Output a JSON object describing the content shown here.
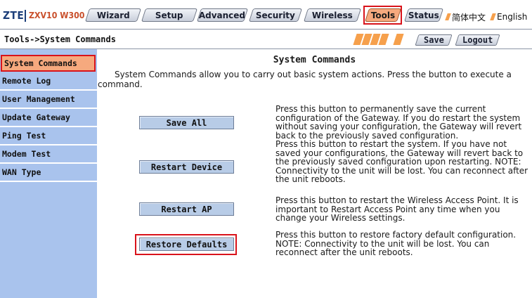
{
  "brand": {
    "logo": "ZTE",
    "model": "ZXV10 W300"
  },
  "nav": {
    "tabs": [
      {
        "label": "Wizard"
      },
      {
        "label": "Setup"
      },
      {
        "label": "Advanced"
      },
      {
        "label": "Security"
      },
      {
        "label": "Wireless"
      },
      {
        "label": "Tools",
        "active": true
      },
      {
        "label": "Status"
      }
    ],
    "languages": [
      "简体中文",
      "English"
    ]
  },
  "breadcrumb": "Tools->System Commands",
  "toolbar": {
    "save_label": "Save",
    "logout_label": "Logout"
  },
  "sidebar": {
    "items": [
      {
        "label": "System Commands",
        "active": true
      },
      {
        "label": "Remote Log"
      },
      {
        "label": "User Management"
      },
      {
        "label": "Update Gateway"
      },
      {
        "label": "Ping Test"
      },
      {
        "label": "Modem Test"
      },
      {
        "label": "WAN Type"
      }
    ]
  },
  "main": {
    "title": "System Commands",
    "description": "System Commands allow you to carry out basic system actions. Press the button to execute a command.",
    "actions": [
      {
        "button": "Save All",
        "text": "Press this button to permanently save the current configuration of the Gateway. If you do restart the system without saving your configuration, the Gateway will revert back to the previously saved configuration."
      },
      {
        "button": "Restart Device",
        "text": "Press this button to restart the system. If you have not saved your configurations, the Gateway will revert back to the previously saved configuration upon restarting. NOTE: Connectivity to the unit will be lost. You can reconnect after the unit reboots."
      },
      {
        "button": "Restart AP",
        "text": "Press this button to restart the Wireless Access Point. It is important to Restart Access Point any time when you change your Wireless settings."
      },
      {
        "button": "Restore Defaults",
        "text": "Press this button to restore factory default configuration. NOTE: Connectivity to the unit will be lost. You can reconnect after the unit reboots."
      }
    ]
  },
  "colors": {
    "sidebar_bg": "#a9c3ed",
    "active_bg": "#f6a97e",
    "highlight_border": "#d9131b",
    "accent_orange": "#f6a04c",
    "button_bg": "#b8cce7"
  }
}
